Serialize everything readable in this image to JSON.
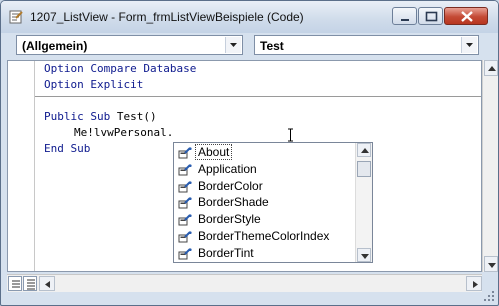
{
  "window": {
    "title": "1207_ListView - Form_frmListViewBeispiele (Code)"
  },
  "combos": {
    "object": "(Allgemein)",
    "procedure": "Test"
  },
  "code": {
    "line1": "Option Compare Database",
    "line2": "Option Explicit",
    "line3_kw": "Public Sub",
    "line3_name": " Test()",
    "line4": "Me!lvwPersonal.",
    "line5": "End Sub"
  },
  "autocomplete": {
    "selected": "About",
    "items": [
      "About",
      "Application",
      "BorderColor",
      "BorderShade",
      "BorderStyle",
      "BorderThemeColorIndex",
      "BorderTint"
    ]
  },
  "icons": {
    "property": "property-icon",
    "dropdown": "chevron-down-icon",
    "minimize": "minimize-icon",
    "maximize": "maximize-icon",
    "close": "close-icon"
  },
  "colors": {
    "keyword": "#0e1a8e",
    "close_button": "#c44a35"
  }
}
